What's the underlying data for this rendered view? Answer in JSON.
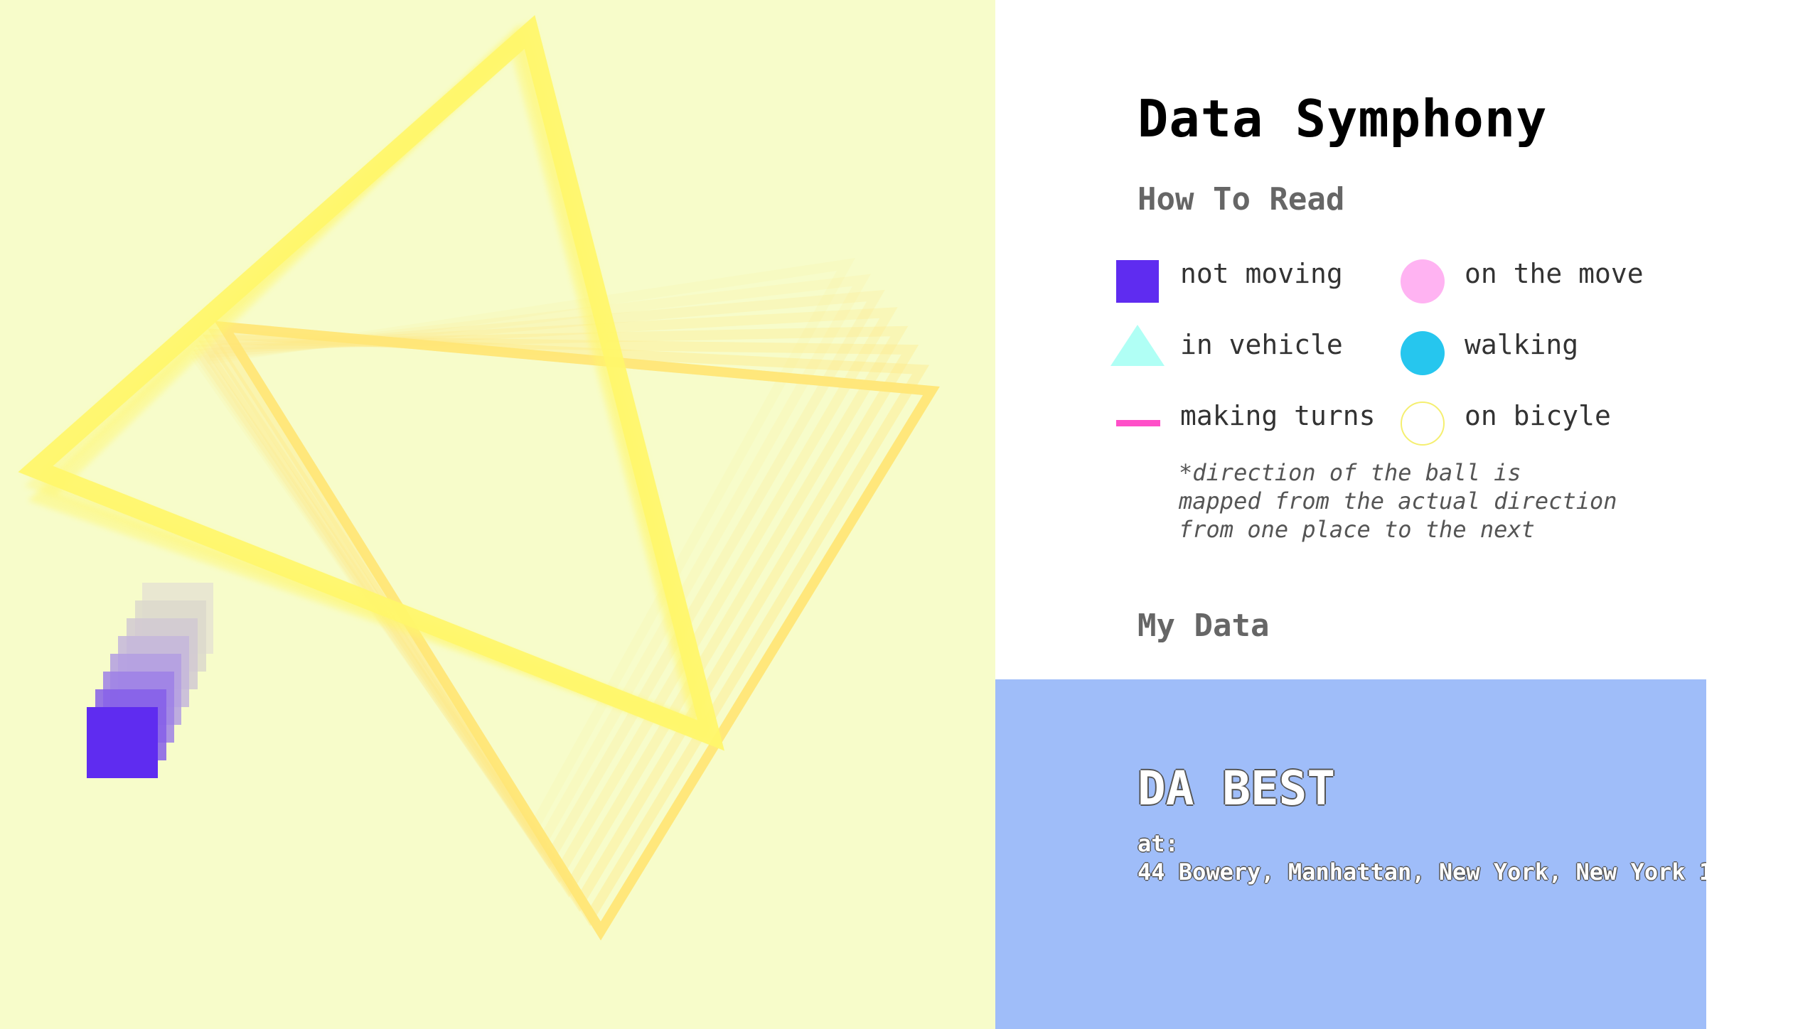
{
  "title": "Data Symphony",
  "how_to_read": {
    "heading": "How To Read",
    "legend": [
      {
        "label": "not moving",
        "icon": "square",
        "color": "#5f2cf0"
      },
      {
        "label": "on the move",
        "icon": "circle",
        "color": "#ffb3f2"
      },
      {
        "label": "in vehicle",
        "icon": "triangle",
        "color": "#b0fff5"
      },
      {
        "label": "walking",
        "icon": "circle",
        "color": "#26c6ee"
      },
      {
        "label": "making turns",
        "icon": "line",
        "color": "#ff4fc8"
      },
      {
        "label": "on bicyle",
        "icon": "circle-outline",
        "color": "#f5ef70"
      }
    ],
    "note": "*direction of the ball is\nmapped from the actual direction\nfrom one place to the next"
  },
  "my_data": {
    "heading": "My Data",
    "place": {
      "name": "DA BEST",
      "at_label": "at:",
      "address": "44 Bowery, Manhattan, New York, New York 1"
    }
  },
  "colors": {
    "canvas_bg": "#f7fcca",
    "triangle_stroke": "#fff66a",
    "square": "#5f2cf0",
    "card_bg": "#9fbdf9"
  }
}
